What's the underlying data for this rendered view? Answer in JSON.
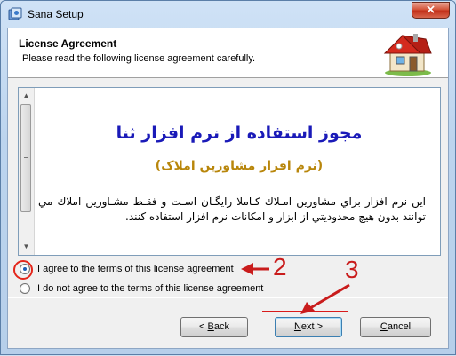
{
  "window": {
    "title": "Sana Setup",
    "close_glyph": "×"
  },
  "header": {
    "title": "License Agreement",
    "subtitle": "Please read the following license agreement carefully.",
    "icon": "house-icon"
  },
  "license": {
    "title": "مجوز استفاده از نرم افزار ثنا",
    "subtitle": "(نرم افزار مشاورین املاک)",
    "body": "این نرم افزار براي مشاورين امـلاك كـاملا رايگـان اسـت و فقـط مشـاورين املاك مي توانند بدون هيچ محدوديتي از ابزار و امكانات نرم افزار استفاده كنند."
  },
  "options": [
    {
      "label": "I agree to the terms of this license agreement",
      "checked": true
    },
    {
      "label": "I do not agree to the terms of this license agreement",
      "checked": false
    }
  ],
  "buttons": {
    "back_prefix": "< ",
    "back_accel": "B",
    "back_rest": "ack",
    "next_accel": "N",
    "next_rest": "ext >",
    "cancel_accel": "C",
    "cancel_rest": "ancel"
  },
  "annotations": {
    "step2": "2",
    "step3": "3",
    "color": "#c91c1c"
  }
}
